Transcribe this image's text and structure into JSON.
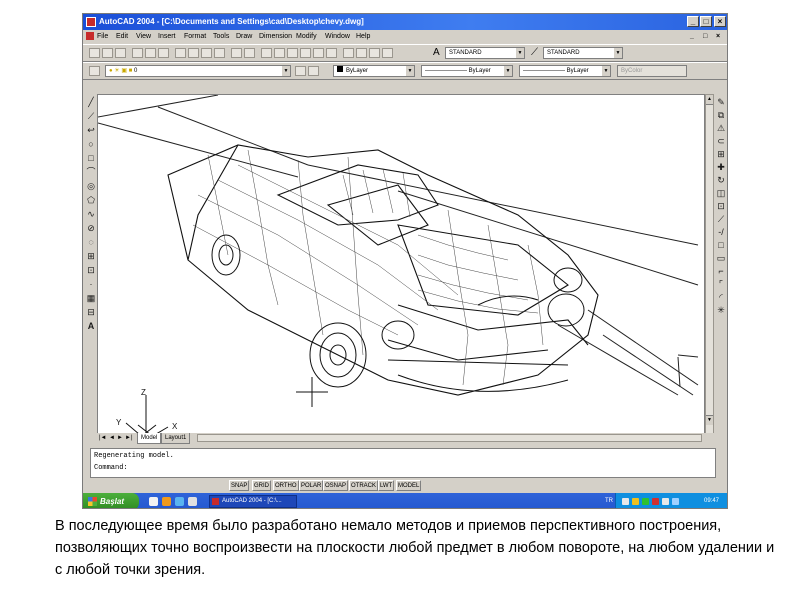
{
  "window": {
    "title": "AutoCAD 2004 - [C:\\Documents and Settings\\cad\\Desktop\\chevy.dwg]",
    "controls": [
      "_",
      "□",
      "×"
    ],
    "doc_controls": [
      "_",
      "□",
      "×"
    ]
  },
  "menu": {
    "items": [
      "File",
      "Edit",
      "View",
      "Insert",
      "Format",
      "Tools",
      "Draw",
      "Dimension",
      "Modify",
      "Window",
      "Help"
    ]
  },
  "standard_toolbar": {
    "text_style": "STANDARD",
    "dim_style": "STANDARD"
  },
  "properties_toolbar": {
    "layer": "0",
    "color": "ByLayer",
    "linetype": "ByLayer",
    "lineweight": "ByLayer",
    "plotstyle": "ByColor"
  },
  "left_toolbar": [
    "╱",
    "⟋",
    "↩",
    "○",
    "□",
    "⌒",
    "◎",
    "⬠",
    "∿",
    "⊘",
    "◌",
    "⊞",
    "⊡",
    "·",
    "▦",
    "⊟",
    "A"
  ],
  "right_toolbar": [
    "✎",
    "⧉",
    "⚠",
    "⊂",
    "⊞",
    "✚",
    "↻",
    "◫",
    "⊡",
    "⟋",
    "-/",
    "□",
    "▭",
    "⌐",
    "⌜",
    "◜",
    "✳"
  ],
  "ucs": {
    "x_label": "X",
    "y_label": "Y",
    "z_label": "Z"
  },
  "layout_tabs": {
    "nav": [
      "|◄",
      "◄",
      "►",
      "►|"
    ],
    "tabs": [
      "Model",
      "Layout1"
    ]
  },
  "command": {
    "line1": "Regenerating model.",
    "line2": "Command:"
  },
  "status": {
    "coords": "",
    "buttons": [
      "SNAP",
      "GRID",
      "ORTHO",
      "POLAR",
      "OSNAP",
      "OTRACK",
      "LWT",
      "MODEL"
    ]
  },
  "taskbar": {
    "start_label": "Başlat",
    "task_label": "AutoCAD 2004 - [C:\\...",
    "lang": "TR",
    "clock": "09:47"
  },
  "caption": "В последующее время было разработано немало методов и приемов перспективного построения, позволяющих точно воспроизвести на плоскости любой предмет в любом повороте, на любом удалении и с любой точки зрения."
}
